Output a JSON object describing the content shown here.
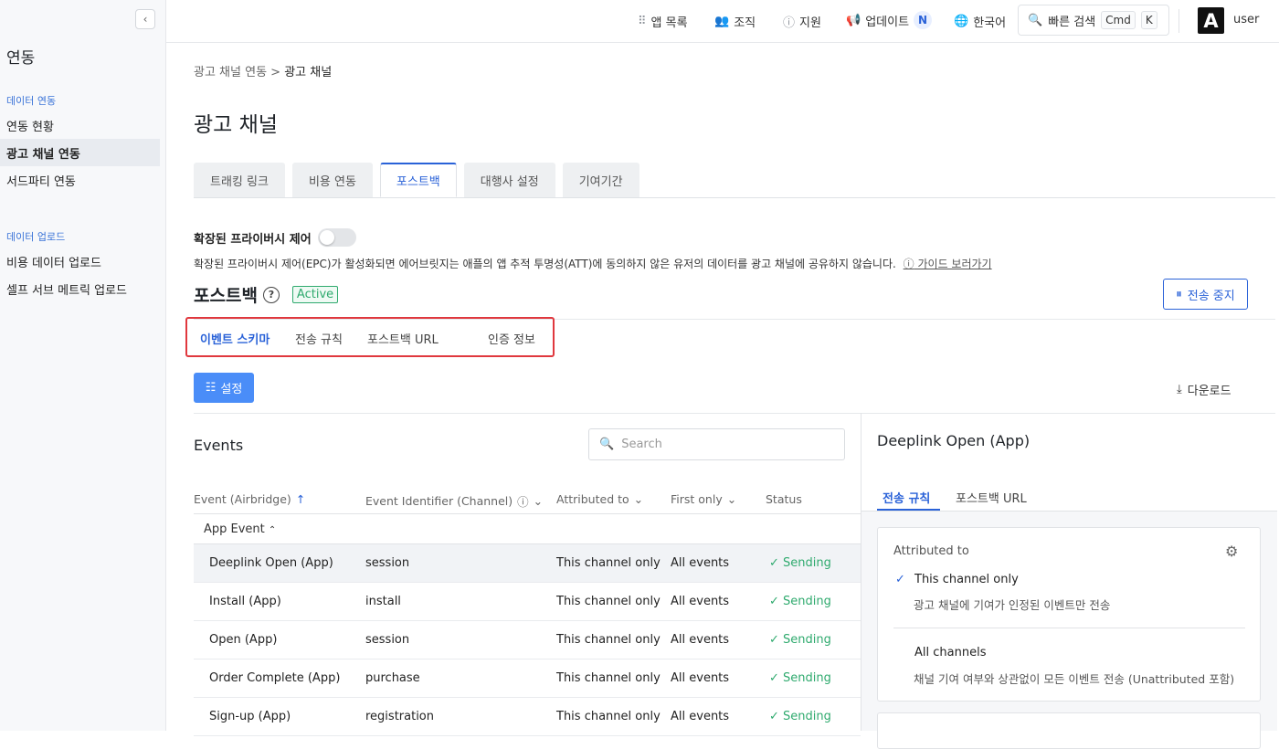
{
  "sidebar": {
    "collapse_icon": "chevron-left-icon",
    "title": "연동",
    "section_data_integration": "데이터 연동",
    "items_integration": [
      {
        "label": "연동 현황"
      },
      {
        "label": "광고 채널 연동",
        "active": true
      },
      {
        "label": "서드파티 연동"
      }
    ],
    "section_data_upload": "데이터 업로드",
    "items_upload": [
      {
        "label": "비용 데이터 업로드"
      },
      {
        "label": "셀프 서브 메트릭 업로드"
      }
    ]
  },
  "topbar": {
    "app_list": "앱 목록",
    "org": "조직",
    "support": "지원",
    "updates": "업데이트",
    "updates_badge": "N",
    "language": "한국어",
    "quick_search": "빠른 검색",
    "kbd_cmd": "Cmd",
    "kbd_k": "K",
    "avatar_letter": "A",
    "username": "user"
  },
  "breadcrumb": {
    "parent": "광고 채널 연동",
    "separator": ">",
    "current": "광고 채널"
  },
  "page_title": "광고 채널",
  "tabs": [
    {
      "label": "트래킹 링크"
    },
    {
      "label": "비용 연동"
    },
    {
      "label": "포스트백",
      "active": true
    },
    {
      "label": "대행사 설정"
    },
    {
      "label": "기여기간"
    }
  ],
  "privacy": {
    "label": "확장된 프라이버시 제어",
    "enabled": false,
    "description": "확장된 프라이버시 제어(EPC)가 활성화되면 에어브릿지는 애플의 앱 추적 투명성(ATT)에 동의하지 않은 유저의 데이터를 광고 채널에 공유하지 않습니다.",
    "guide_link": "가이드 보러가기"
  },
  "postback": {
    "title": "포스트백",
    "status_badge": "Active",
    "stop_button": "전송 중지"
  },
  "subtabs": [
    {
      "label": "이벤트 스키마",
      "active": true
    },
    {
      "label": "전송 규칙"
    },
    {
      "label": "포스트백 URL"
    },
    {
      "label": "인증 정보"
    }
  ],
  "settings_button": "설정",
  "download_button": "다운로드",
  "events": {
    "title": "Events",
    "search_placeholder": "Search",
    "columns": {
      "event": "Event (Airbridge)",
      "identifier": "Event Identifier (Channel)",
      "attributed": "Attributed to",
      "first_only": "First only",
      "status": "Status"
    },
    "group_label": "App Event",
    "rows": [
      {
        "event": "Deeplink Open (App)",
        "identifier": "session",
        "attributed": "This channel only",
        "first_only": "All events",
        "status": "Sending"
      },
      {
        "event": "Install (App)",
        "identifier": "install",
        "attributed": "This channel only",
        "first_only": "All events",
        "status": "Sending"
      },
      {
        "event": "Open (App)",
        "identifier": "session",
        "attributed": "This channel only",
        "first_only": "All events",
        "status": "Sending"
      },
      {
        "event": "Order Complete (App)",
        "identifier": "purchase",
        "attributed": "This channel only",
        "first_only": "All events",
        "status": "Sending"
      },
      {
        "event": "Sign-up (App)",
        "identifier": "registration",
        "attributed": "This channel only",
        "first_only": "All events",
        "status": "Sending"
      }
    ]
  },
  "detail": {
    "title": "Deeplink Open (App)",
    "tabs": [
      {
        "label": "전송 규칙",
        "active": true
      },
      {
        "label": "포스트백 URL"
      }
    ],
    "card_label": "Attributed to",
    "options": [
      {
        "title": "This channel only",
        "desc": "광고 채널에 기여가 인정된 이벤트만 전송",
        "selected": true
      },
      {
        "title": "All channels",
        "desc": "채널 기여 여부와 상관없이 모든 이벤트 전송 (Unattributed 포함)",
        "selected": false
      }
    ]
  },
  "colors": {
    "accent": "#2a62d8",
    "success": "#2faa6e",
    "highlight_border": "#e0383e",
    "primary_button": "#4a8df8"
  }
}
